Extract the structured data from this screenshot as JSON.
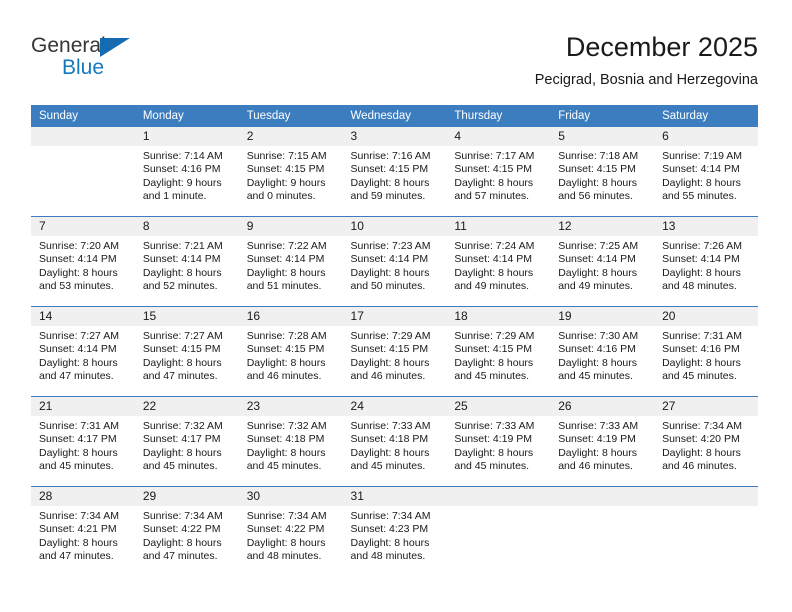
{
  "logo": {
    "word_top": "General",
    "word_bottom": "Blue",
    "triangle_color": "#156bb1",
    "blue_text_color": "#1479bd"
  },
  "header": {
    "title": "December 2025",
    "subtitle": "Pecigrad, Bosnia and Herzegovina"
  },
  "calendar": {
    "header_bg": "#3b7dbf",
    "daynum_bg": "#f0f0f0",
    "weekdays": [
      "Sunday",
      "Monday",
      "Tuesday",
      "Wednesday",
      "Thursday",
      "Friday",
      "Saturday"
    ],
    "weeks": [
      [
        {
          "day": "",
          "sunrise": "",
          "sunset": "",
          "daylight_1": "",
          "daylight_2": ""
        },
        {
          "day": "1",
          "sunrise": "Sunrise: 7:14 AM",
          "sunset": "Sunset: 4:16 PM",
          "daylight_1": "Daylight: 9 hours",
          "daylight_2": "and 1 minute."
        },
        {
          "day": "2",
          "sunrise": "Sunrise: 7:15 AM",
          "sunset": "Sunset: 4:15 PM",
          "daylight_1": "Daylight: 9 hours",
          "daylight_2": "and 0 minutes."
        },
        {
          "day": "3",
          "sunrise": "Sunrise: 7:16 AM",
          "sunset": "Sunset: 4:15 PM",
          "daylight_1": "Daylight: 8 hours",
          "daylight_2": "and 59 minutes."
        },
        {
          "day": "4",
          "sunrise": "Sunrise: 7:17 AM",
          "sunset": "Sunset: 4:15 PM",
          "daylight_1": "Daylight: 8 hours",
          "daylight_2": "and 57 minutes."
        },
        {
          "day": "5",
          "sunrise": "Sunrise: 7:18 AM",
          "sunset": "Sunset: 4:15 PM",
          "daylight_1": "Daylight: 8 hours",
          "daylight_2": "and 56 minutes."
        },
        {
          "day": "6",
          "sunrise": "Sunrise: 7:19 AM",
          "sunset": "Sunset: 4:14 PM",
          "daylight_1": "Daylight: 8 hours",
          "daylight_2": "and 55 minutes."
        }
      ],
      [
        {
          "day": "7",
          "sunrise": "Sunrise: 7:20 AM",
          "sunset": "Sunset: 4:14 PM",
          "daylight_1": "Daylight: 8 hours",
          "daylight_2": "and 53 minutes."
        },
        {
          "day": "8",
          "sunrise": "Sunrise: 7:21 AM",
          "sunset": "Sunset: 4:14 PM",
          "daylight_1": "Daylight: 8 hours",
          "daylight_2": "and 52 minutes."
        },
        {
          "day": "9",
          "sunrise": "Sunrise: 7:22 AM",
          "sunset": "Sunset: 4:14 PM",
          "daylight_1": "Daylight: 8 hours",
          "daylight_2": "and 51 minutes."
        },
        {
          "day": "10",
          "sunrise": "Sunrise: 7:23 AM",
          "sunset": "Sunset: 4:14 PM",
          "daylight_1": "Daylight: 8 hours",
          "daylight_2": "and 50 minutes."
        },
        {
          "day": "11",
          "sunrise": "Sunrise: 7:24 AM",
          "sunset": "Sunset: 4:14 PM",
          "daylight_1": "Daylight: 8 hours",
          "daylight_2": "and 49 minutes."
        },
        {
          "day": "12",
          "sunrise": "Sunrise: 7:25 AM",
          "sunset": "Sunset: 4:14 PM",
          "daylight_1": "Daylight: 8 hours",
          "daylight_2": "and 49 minutes."
        },
        {
          "day": "13",
          "sunrise": "Sunrise: 7:26 AM",
          "sunset": "Sunset: 4:14 PM",
          "daylight_1": "Daylight: 8 hours",
          "daylight_2": "and 48 minutes."
        }
      ],
      [
        {
          "day": "14",
          "sunrise": "Sunrise: 7:27 AM",
          "sunset": "Sunset: 4:14 PM",
          "daylight_1": "Daylight: 8 hours",
          "daylight_2": "and 47 minutes."
        },
        {
          "day": "15",
          "sunrise": "Sunrise: 7:27 AM",
          "sunset": "Sunset: 4:15 PM",
          "daylight_1": "Daylight: 8 hours",
          "daylight_2": "and 47 minutes."
        },
        {
          "day": "16",
          "sunrise": "Sunrise: 7:28 AM",
          "sunset": "Sunset: 4:15 PM",
          "daylight_1": "Daylight: 8 hours",
          "daylight_2": "and 46 minutes."
        },
        {
          "day": "17",
          "sunrise": "Sunrise: 7:29 AM",
          "sunset": "Sunset: 4:15 PM",
          "daylight_1": "Daylight: 8 hours",
          "daylight_2": "and 46 minutes."
        },
        {
          "day": "18",
          "sunrise": "Sunrise: 7:29 AM",
          "sunset": "Sunset: 4:15 PM",
          "daylight_1": "Daylight: 8 hours",
          "daylight_2": "and 45 minutes."
        },
        {
          "day": "19",
          "sunrise": "Sunrise: 7:30 AM",
          "sunset": "Sunset: 4:16 PM",
          "daylight_1": "Daylight: 8 hours",
          "daylight_2": "and 45 minutes."
        },
        {
          "day": "20",
          "sunrise": "Sunrise: 7:31 AM",
          "sunset": "Sunset: 4:16 PM",
          "daylight_1": "Daylight: 8 hours",
          "daylight_2": "and 45 minutes."
        }
      ],
      [
        {
          "day": "21",
          "sunrise": "Sunrise: 7:31 AM",
          "sunset": "Sunset: 4:17 PM",
          "daylight_1": "Daylight: 8 hours",
          "daylight_2": "and 45 minutes."
        },
        {
          "day": "22",
          "sunrise": "Sunrise: 7:32 AM",
          "sunset": "Sunset: 4:17 PM",
          "daylight_1": "Daylight: 8 hours",
          "daylight_2": "and 45 minutes."
        },
        {
          "day": "23",
          "sunrise": "Sunrise: 7:32 AM",
          "sunset": "Sunset: 4:18 PM",
          "daylight_1": "Daylight: 8 hours",
          "daylight_2": "and 45 minutes."
        },
        {
          "day": "24",
          "sunrise": "Sunrise: 7:33 AM",
          "sunset": "Sunset: 4:18 PM",
          "daylight_1": "Daylight: 8 hours",
          "daylight_2": "and 45 minutes."
        },
        {
          "day": "25",
          "sunrise": "Sunrise: 7:33 AM",
          "sunset": "Sunset: 4:19 PM",
          "daylight_1": "Daylight: 8 hours",
          "daylight_2": "and 45 minutes."
        },
        {
          "day": "26",
          "sunrise": "Sunrise: 7:33 AM",
          "sunset": "Sunset: 4:19 PM",
          "daylight_1": "Daylight: 8 hours",
          "daylight_2": "and 46 minutes."
        },
        {
          "day": "27",
          "sunrise": "Sunrise: 7:34 AM",
          "sunset": "Sunset: 4:20 PM",
          "daylight_1": "Daylight: 8 hours",
          "daylight_2": "and 46 minutes."
        }
      ],
      [
        {
          "day": "28",
          "sunrise": "Sunrise: 7:34 AM",
          "sunset": "Sunset: 4:21 PM",
          "daylight_1": "Daylight: 8 hours",
          "daylight_2": "and 47 minutes."
        },
        {
          "day": "29",
          "sunrise": "Sunrise: 7:34 AM",
          "sunset": "Sunset: 4:22 PM",
          "daylight_1": "Daylight: 8 hours",
          "daylight_2": "and 47 minutes."
        },
        {
          "day": "30",
          "sunrise": "Sunrise: 7:34 AM",
          "sunset": "Sunset: 4:22 PM",
          "daylight_1": "Daylight: 8 hours",
          "daylight_2": "and 48 minutes."
        },
        {
          "day": "31",
          "sunrise": "Sunrise: 7:34 AM",
          "sunset": "Sunset: 4:23 PM",
          "daylight_1": "Daylight: 8 hours",
          "daylight_2": "and 48 minutes."
        },
        {
          "day": "",
          "sunrise": "",
          "sunset": "",
          "daylight_1": "",
          "daylight_2": ""
        },
        {
          "day": "",
          "sunrise": "",
          "sunset": "",
          "daylight_1": "",
          "daylight_2": ""
        },
        {
          "day": "",
          "sunrise": "",
          "sunset": "",
          "daylight_1": "",
          "daylight_2": ""
        }
      ]
    ]
  }
}
